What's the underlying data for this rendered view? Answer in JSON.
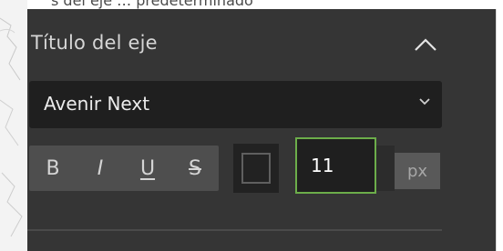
{
  "top_fragment": {
    "text": "s del eje … predeterminado"
  },
  "axis_title_section": {
    "title": "Título del eje",
    "collapse_icon": "chevron-up-icon",
    "font_select": {
      "value": "Avenir Next",
      "chevron_icon": "chevron-down-icon"
    },
    "text_style": {
      "bold_label": "B",
      "italic_label": "I",
      "underline_label": "U",
      "strike_label": "S"
    },
    "font_color": "#222222",
    "font_size": {
      "value": "11",
      "unit_label": "px"
    }
  },
  "colors": {
    "panel_bg": "#353535",
    "focus_border": "#6cad4a",
    "input_bg": "#1f1f1f"
  }
}
